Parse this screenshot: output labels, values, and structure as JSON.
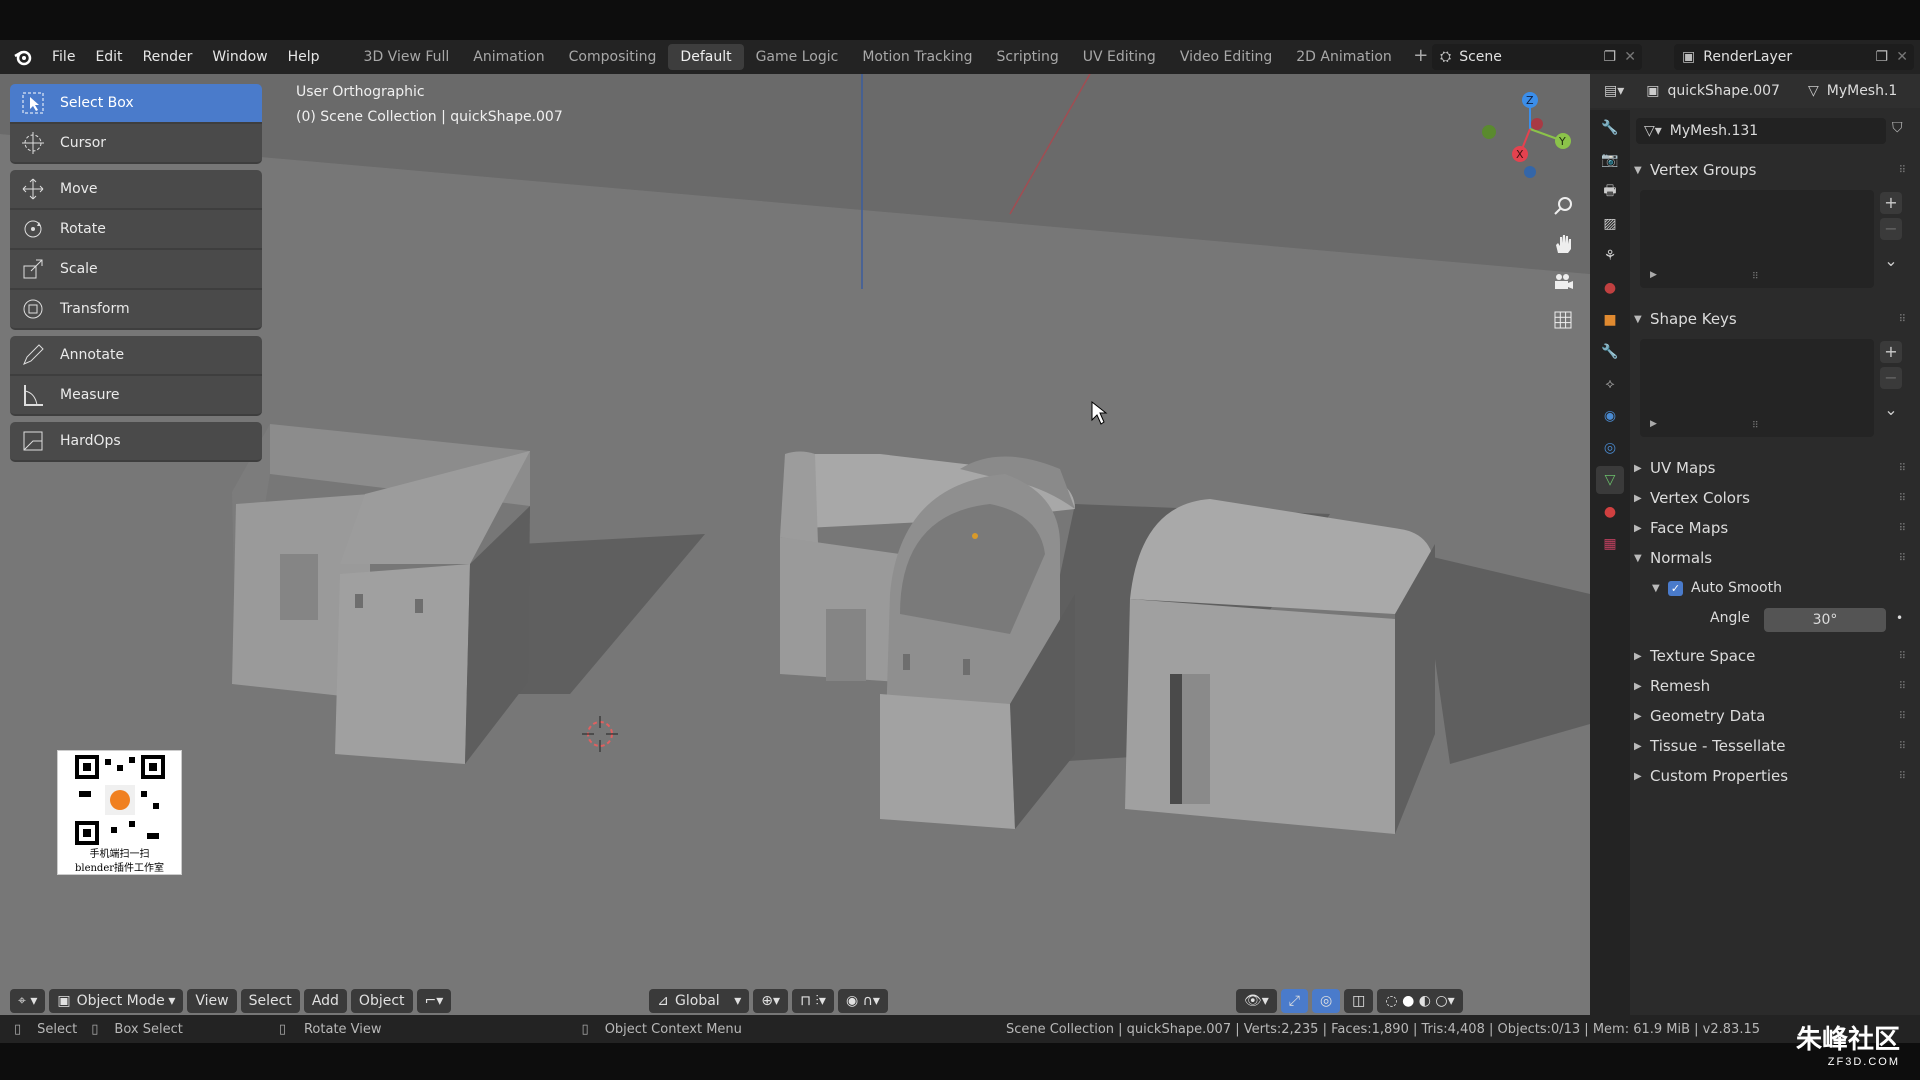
{
  "menu": [
    "File",
    "Edit",
    "Render",
    "Window",
    "Help"
  ],
  "workspaces": [
    "3D View Full",
    "Animation",
    "Compositing",
    "Default",
    "Game Logic",
    "Motion Tracking",
    "Scripting",
    "UV Editing",
    "Video Editing",
    "2D Animation"
  ],
  "active_workspace": "Default",
  "scene": {
    "name": "Scene",
    "view_layer": "RenderLayer"
  },
  "tools": [
    "Select Box",
    "Cursor",
    "Move",
    "Rotate",
    "Scale",
    "Transform",
    "Annotate",
    "Measure",
    "HardOps"
  ],
  "viewport": {
    "view_name": "User Orthographic",
    "collection_line": "(0) Scene Collection | quickShape.007"
  },
  "viewport_header": {
    "mode": "Object Mode",
    "view": "View",
    "select": "Select",
    "add": "Add",
    "object": "Object",
    "orientation": "Global"
  },
  "properties": {
    "object_name": "quickShape.007",
    "data_name_short": "MyMesh.1",
    "mesh_name": "MyMesh.131",
    "panels": {
      "vertex_groups": "Vertex Groups",
      "shape_keys": "Shape Keys",
      "uv_maps": "UV Maps",
      "vertex_colors": "Vertex Colors",
      "face_maps": "Face Maps",
      "normals": "Normals",
      "auto_smooth": "Auto Smooth",
      "angle_label": "Angle",
      "angle_value": "30°",
      "texture_space": "Texture Space",
      "remesh": "Remesh",
      "geometry_data": "Geometry Data",
      "tissue": "Tissue - Tessellate",
      "custom_properties": "Custom Properties"
    }
  },
  "status": {
    "select": "Select",
    "box_select": "Box Select",
    "rotate_view": "Rotate View",
    "context_menu": "Object Context Menu",
    "stats": "Scene Collection | quickShape.007 | Verts:2,235 | Faces:1,890 | Tris:4,408 | Objects:0/13 | Mem: 61.9 MiB | v2.83.15"
  },
  "watermark": {
    "qr_text_1": "手机端扫一扫",
    "qr_text_2": "blender插件工作室",
    "site_cn": "朱峰社区",
    "site_en": "ZF3D.COM"
  },
  "colors": {
    "accent": "#4a7bcb",
    "viewport": "#6f6f6f",
    "panel": "#2b2b2b",
    "axis_x": "#e4424f",
    "axis_y": "#8bc34a",
    "axis_z": "#3b8eea"
  }
}
